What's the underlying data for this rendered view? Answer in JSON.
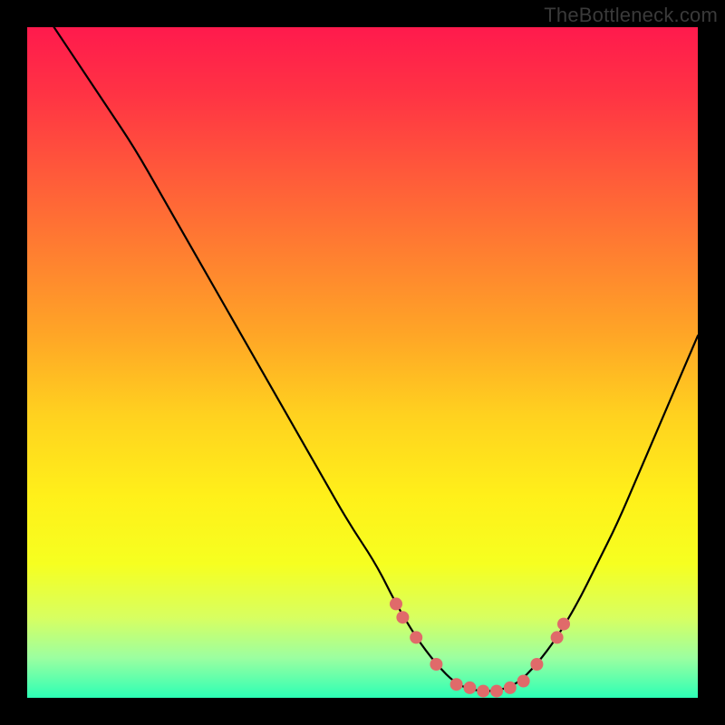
{
  "attribution": "TheBottleneck.com",
  "colors": {
    "frame": "#000000",
    "gradient_top": "#ff1a4d",
    "gradient_bottom": "#2cffb5",
    "curve": "#000000",
    "dots": "#e06a6a"
  },
  "chart_data": {
    "type": "line",
    "title": "",
    "xlabel": "",
    "ylabel": "",
    "xlim": [
      0,
      100
    ],
    "ylim": [
      0,
      100
    ],
    "grid": false,
    "legend": null,
    "annotations": [],
    "series": [
      {
        "name": "bottleneck-curve",
        "x": [
          4,
          8,
          12,
          16,
          20,
          24,
          28,
          32,
          36,
          40,
          44,
          48,
          52,
          55,
          58,
          61,
          64,
          67,
          70,
          73,
          76,
          79,
          82,
          85,
          88,
          91,
          94,
          97,
          100
        ],
        "y": [
          100,
          94,
          88,
          82,
          75,
          68,
          61,
          54,
          47,
          40,
          33,
          26,
          20,
          14,
          9,
          5,
          2,
          1,
          1,
          2,
          5,
          9,
          14,
          20,
          26,
          33,
          40,
          47,
          54
        ]
      }
    ],
    "highlight_points": {
      "name": "bottleneck-dots",
      "x": [
        55,
        56,
        58,
        61,
        64,
        66,
        68,
        70,
        72,
        74,
        76,
        79,
        80
      ],
      "y": [
        14,
        12,
        9,
        5,
        2,
        1.5,
        1,
        1,
        1.5,
        2.5,
        5,
        9,
        11
      ]
    }
  }
}
